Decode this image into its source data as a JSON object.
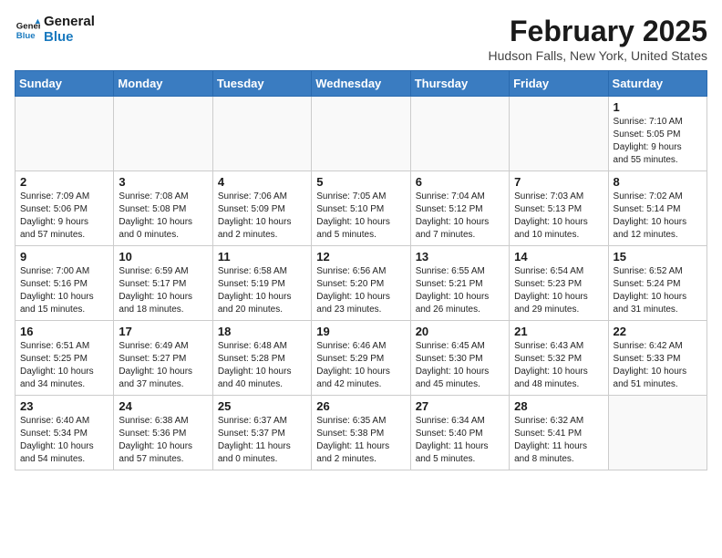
{
  "header": {
    "logo_general": "General",
    "logo_blue": "Blue",
    "title": "February 2025",
    "location": "Hudson Falls, New York, United States"
  },
  "weekdays": [
    "Sunday",
    "Monday",
    "Tuesday",
    "Wednesday",
    "Thursday",
    "Friday",
    "Saturday"
  ],
  "weeks": [
    [
      {
        "day": "",
        "detail": ""
      },
      {
        "day": "",
        "detail": ""
      },
      {
        "day": "",
        "detail": ""
      },
      {
        "day": "",
        "detail": ""
      },
      {
        "day": "",
        "detail": ""
      },
      {
        "day": "",
        "detail": ""
      },
      {
        "day": "1",
        "detail": "Sunrise: 7:10 AM\nSunset: 5:05 PM\nDaylight: 9 hours\nand 55 minutes."
      }
    ],
    [
      {
        "day": "2",
        "detail": "Sunrise: 7:09 AM\nSunset: 5:06 PM\nDaylight: 9 hours\nand 57 minutes."
      },
      {
        "day": "3",
        "detail": "Sunrise: 7:08 AM\nSunset: 5:08 PM\nDaylight: 10 hours\nand 0 minutes."
      },
      {
        "day": "4",
        "detail": "Sunrise: 7:06 AM\nSunset: 5:09 PM\nDaylight: 10 hours\nand 2 minutes."
      },
      {
        "day": "5",
        "detail": "Sunrise: 7:05 AM\nSunset: 5:10 PM\nDaylight: 10 hours\nand 5 minutes."
      },
      {
        "day": "6",
        "detail": "Sunrise: 7:04 AM\nSunset: 5:12 PM\nDaylight: 10 hours\nand 7 minutes."
      },
      {
        "day": "7",
        "detail": "Sunrise: 7:03 AM\nSunset: 5:13 PM\nDaylight: 10 hours\nand 10 minutes."
      },
      {
        "day": "8",
        "detail": "Sunrise: 7:02 AM\nSunset: 5:14 PM\nDaylight: 10 hours\nand 12 minutes."
      }
    ],
    [
      {
        "day": "9",
        "detail": "Sunrise: 7:00 AM\nSunset: 5:16 PM\nDaylight: 10 hours\nand 15 minutes."
      },
      {
        "day": "10",
        "detail": "Sunrise: 6:59 AM\nSunset: 5:17 PM\nDaylight: 10 hours\nand 18 minutes."
      },
      {
        "day": "11",
        "detail": "Sunrise: 6:58 AM\nSunset: 5:19 PM\nDaylight: 10 hours\nand 20 minutes."
      },
      {
        "day": "12",
        "detail": "Sunrise: 6:56 AM\nSunset: 5:20 PM\nDaylight: 10 hours\nand 23 minutes."
      },
      {
        "day": "13",
        "detail": "Sunrise: 6:55 AM\nSunset: 5:21 PM\nDaylight: 10 hours\nand 26 minutes."
      },
      {
        "day": "14",
        "detail": "Sunrise: 6:54 AM\nSunset: 5:23 PM\nDaylight: 10 hours\nand 29 minutes."
      },
      {
        "day": "15",
        "detail": "Sunrise: 6:52 AM\nSunset: 5:24 PM\nDaylight: 10 hours\nand 31 minutes."
      }
    ],
    [
      {
        "day": "16",
        "detail": "Sunrise: 6:51 AM\nSunset: 5:25 PM\nDaylight: 10 hours\nand 34 minutes."
      },
      {
        "day": "17",
        "detail": "Sunrise: 6:49 AM\nSunset: 5:27 PM\nDaylight: 10 hours\nand 37 minutes."
      },
      {
        "day": "18",
        "detail": "Sunrise: 6:48 AM\nSunset: 5:28 PM\nDaylight: 10 hours\nand 40 minutes."
      },
      {
        "day": "19",
        "detail": "Sunrise: 6:46 AM\nSunset: 5:29 PM\nDaylight: 10 hours\nand 42 minutes."
      },
      {
        "day": "20",
        "detail": "Sunrise: 6:45 AM\nSunset: 5:30 PM\nDaylight: 10 hours\nand 45 minutes."
      },
      {
        "day": "21",
        "detail": "Sunrise: 6:43 AM\nSunset: 5:32 PM\nDaylight: 10 hours\nand 48 minutes."
      },
      {
        "day": "22",
        "detail": "Sunrise: 6:42 AM\nSunset: 5:33 PM\nDaylight: 10 hours\nand 51 minutes."
      }
    ],
    [
      {
        "day": "23",
        "detail": "Sunrise: 6:40 AM\nSunset: 5:34 PM\nDaylight: 10 hours\nand 54 minutes."
      },
      {
        "day": "24",
        "detail": "Sunrise: 6:38 AM\nSunset: 5:36 PM\nDaylight: 10 hours\nand 57 minutes."
      },
      {
        "day": "25",
        "detail": "Sunrise: 6:37 AM\nSunset: 5:37 PM\nDaylight: 11 hours\nand 0 minutes."
      },
      {
        "day": "26",
        "detail": "Sunrise: 6:35 AM\nSunset: 5:38 PM\nDaylight: 11 hours\nand 2 minutes."
      },
      {
        "day": "27",
        "detail": "Sunrise: 6:34 AM\nSunset: 5:40 PM\nDaylight: 11 hours\nand 5 minutes."
      },
      {
        "day": "28",
        "detail": "Sunrise: 6:32 AM\nSunset: 5:41 PM\nDaylight: 11 hours\nand 8 minutes."
      },
      {
        "day": "",
        "detail": ""
      }
    ]
  ]
}
